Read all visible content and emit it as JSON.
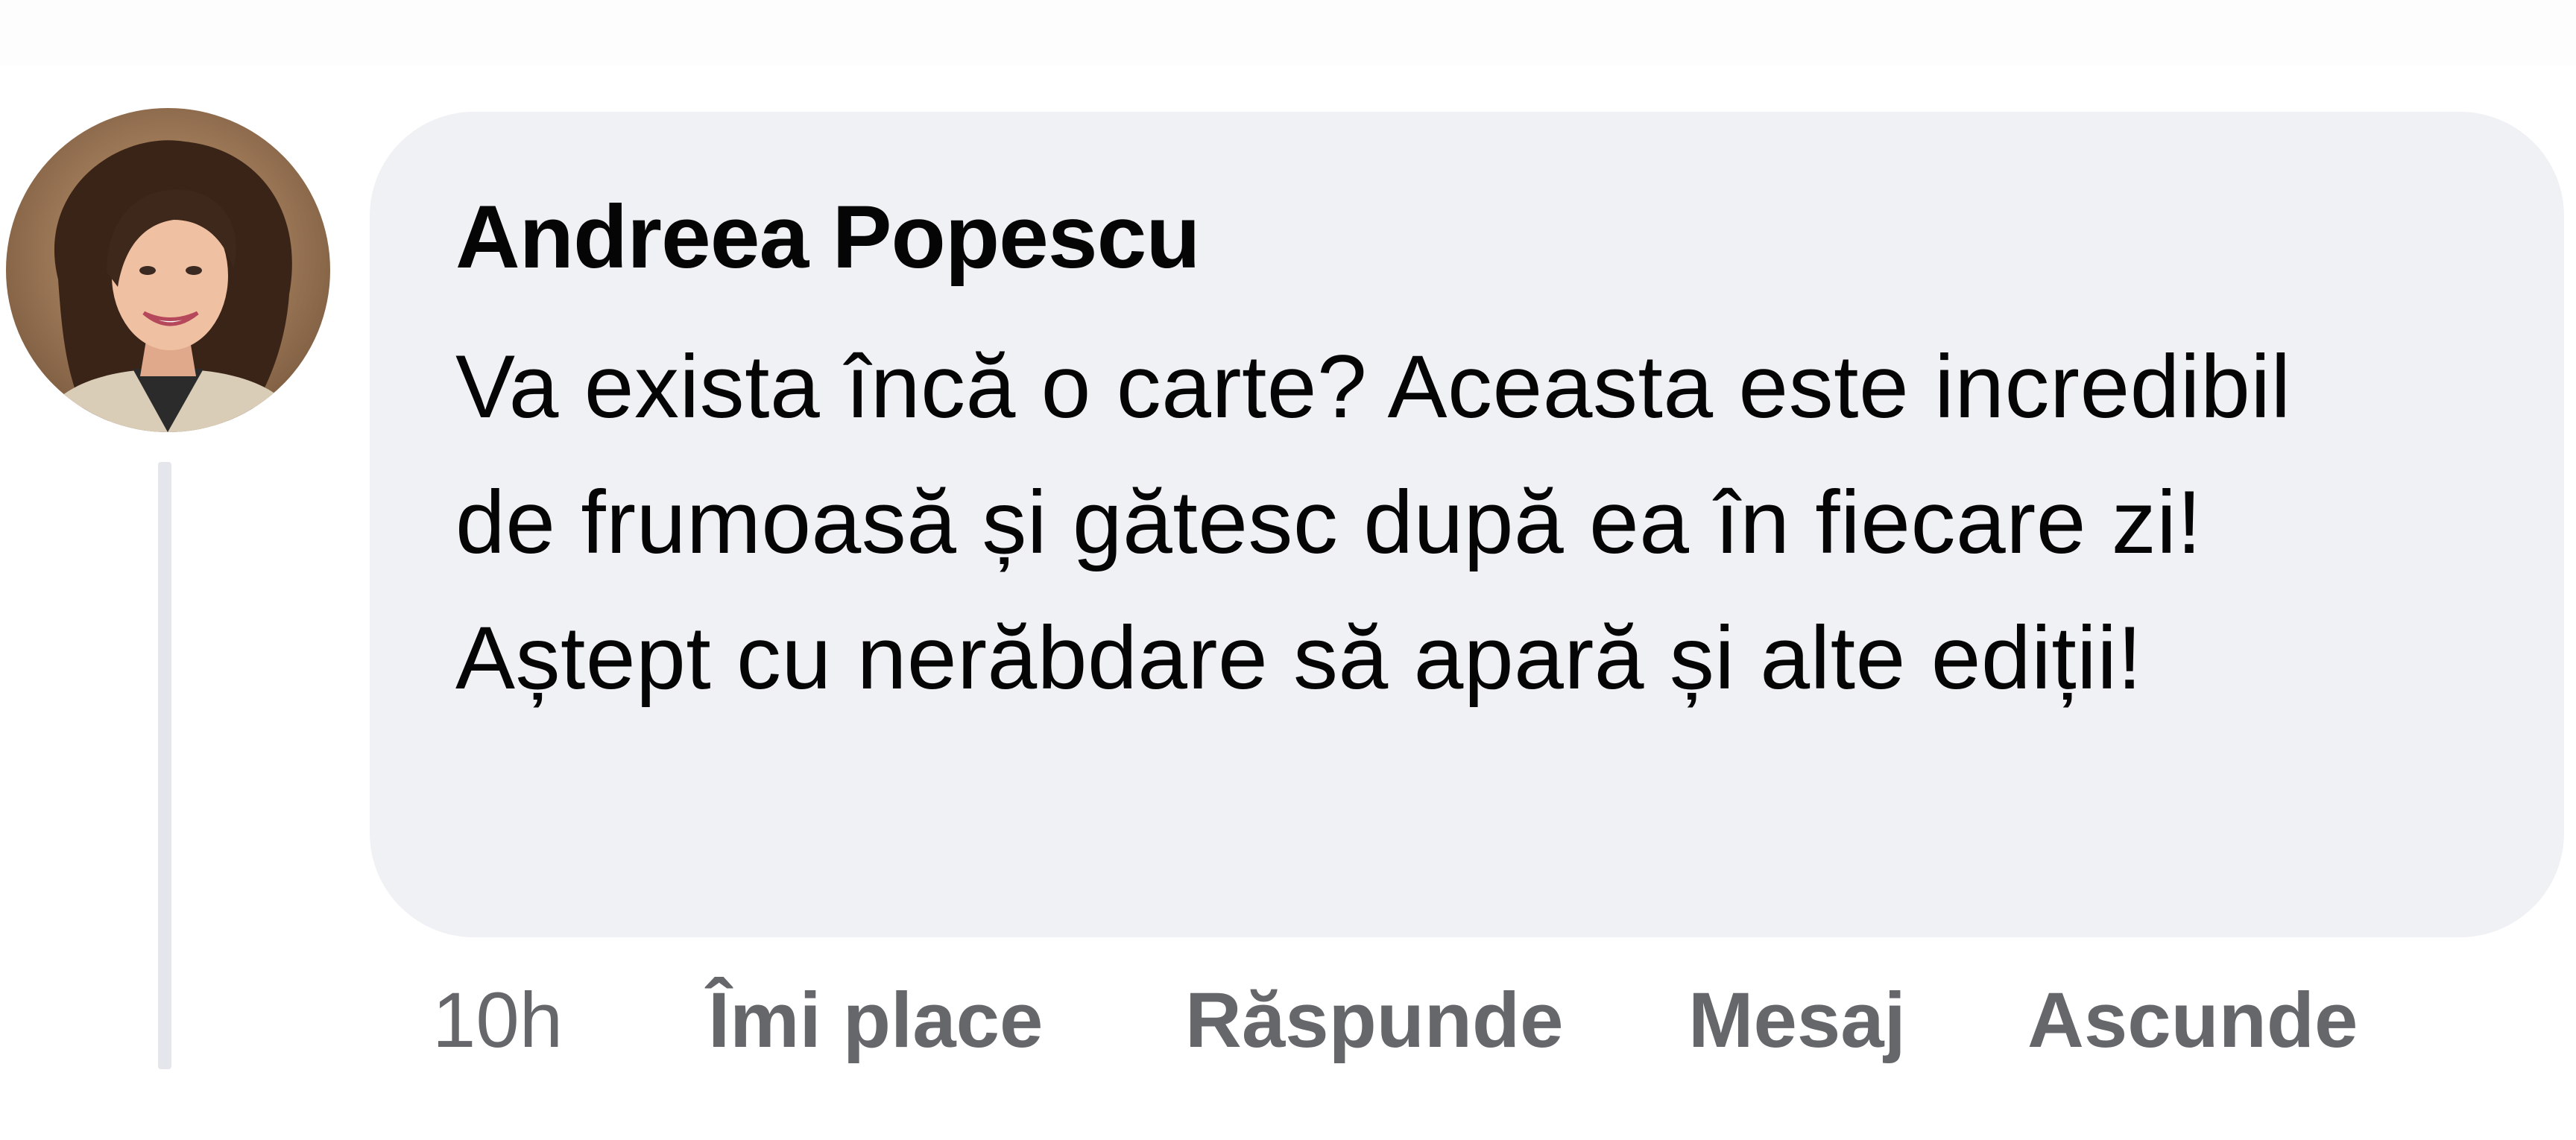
{
  "comment": {
    "author": "Andreea Popescu",
    "text": "Va exista încă o carte? Aceasta este incredibil de frumoasă și gătesc după ea în fiecare zi! Aștept cu nerăbdare să apară și alte ediții!",
    "timestamp": "10h",
    "actions": {
      "like": "Îmi place",
      "reply": "Răspunde",
      "message": "Mesaj",
      "hide": "Ascunde"
    }
  },
  "colors": {
    "bubble_background": "#f0f1f5",
    "text": "#050505",
    "secondary_text": "#65676b",
    "thread_line": "#e4e6eb"
  },
  "icons": {
    "avatar": "profile-photo"
  }
}
